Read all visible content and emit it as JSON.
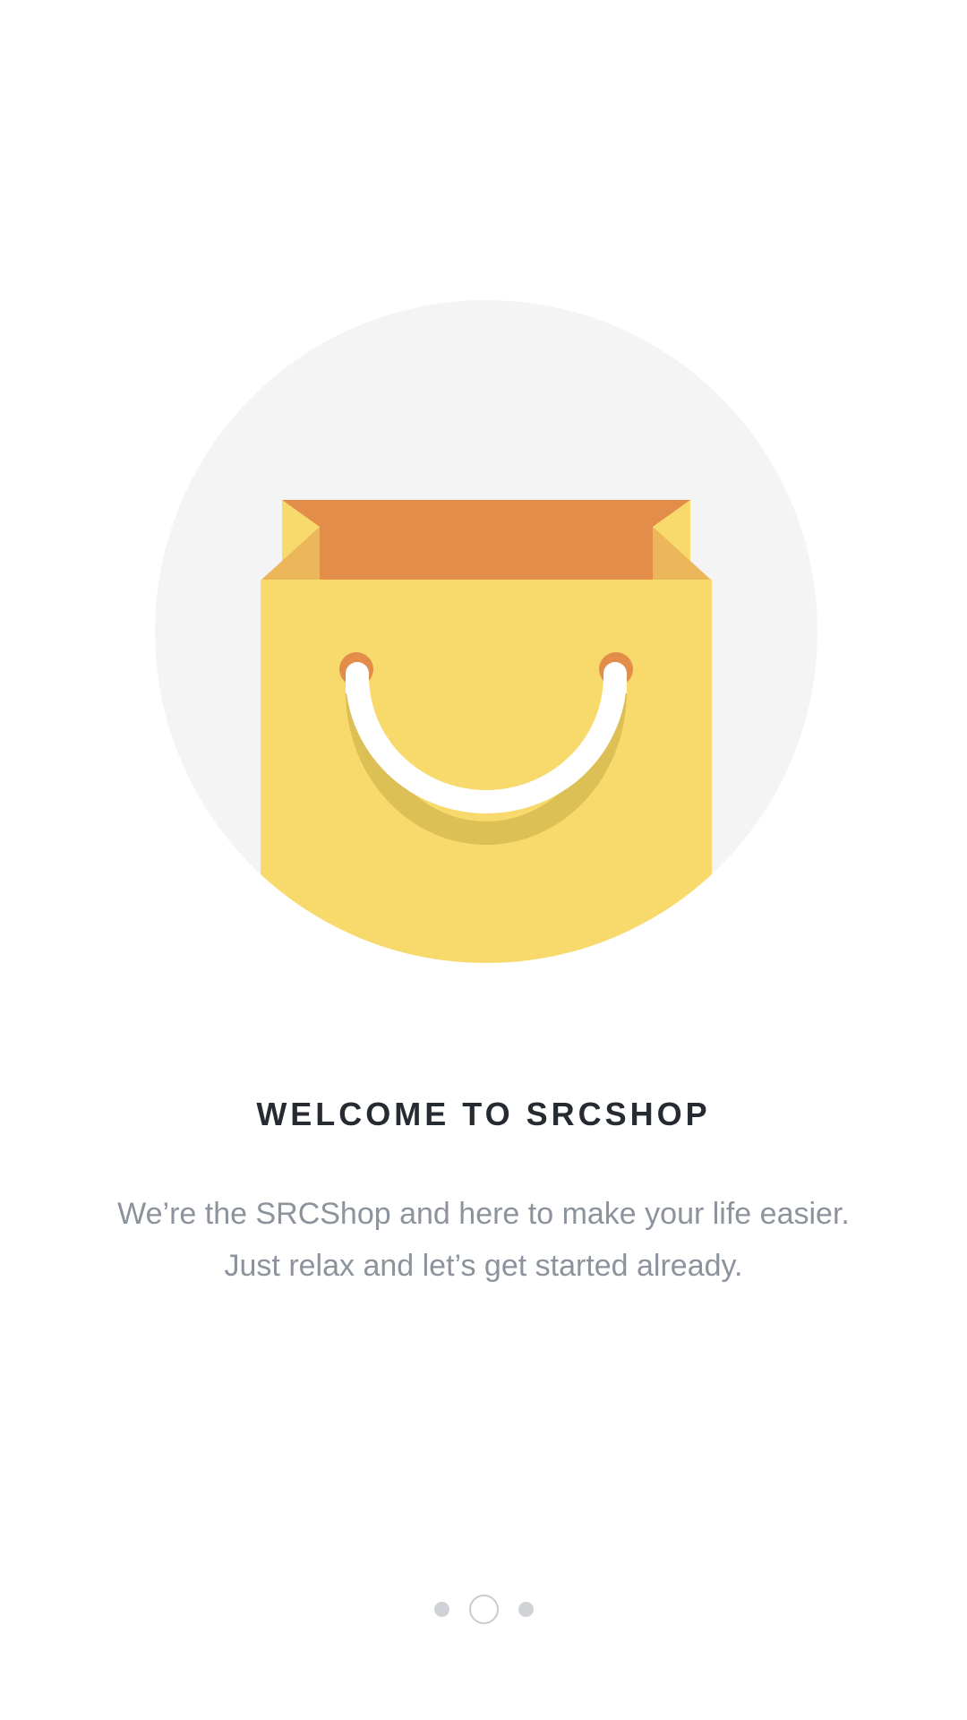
{
  "onboarding": {
    "title": "WELCOME TO SRCSHOP",
    "description_line1": "We’re the SRCShop and here to make your life easier.",
    "description_line2": "Just relax and let’s get started already."
  },
  "illustration": {
    "icon": "shopping-bag-icon",
    "circle_color": "#f4f4f4",
    "bag_color": "#f8d96c",
    "bag_inner_color": "#e38d4a",
    "bag_fold_color": "#ecb65a"
  },
  "pager": {
    "page_count": 3,
    "active_page": 2
  },
  "colors": {
    "background": "#ffffff",
    "title": "#262a31",
    "description": "#8c939c",
    "dot_inactive": "#cfd3d8",
    "dot_active_ring": "#c8ccd1"
  }
}
